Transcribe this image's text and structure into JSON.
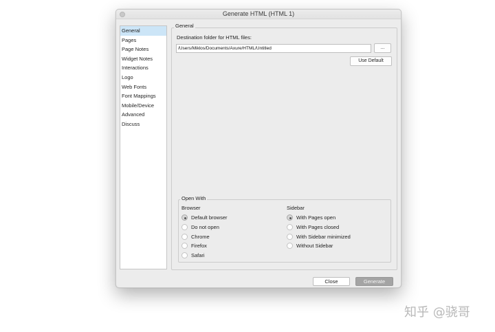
{
  "window": {
    "title": "Generate HTML (HTML 1)"
  },
  "sidebar": {
    "items": [
      {
        "label": "General",
        "selected": true
      },
      {
        "label": "Pages"
      },
      {
        "label": "Page Notes"
      },
      {
        "label": "Widget Notes"
      },
      {
        "label": "Interactions"
      },
      {
        "label": "Logo"
      },
      {
        "label": "Web Fonts"
      },
      {
        "label": "Font Mappings"
      },
      {
        "label": "Mobile/Device"
      },
      {
        "label": "Advanced"
      },
      {
        "label": "Discuss"
      }
    ]
  },
  "general": {
    "group_label": "General",
    "destination_label": "Destination folder for HTML files:",
    "destination_value": "/Users/Miklos/Documents/Axure/HTML/Untitled",
    "browse_label": "...",
    "use_default_label": "Use Default"
  },
  "open_with": {
    "group_label": "Open With",
    "browser": {
      "heading": "Browser",
      "options": [
        "Default browser",
        "Do not open",
        "Chrome",
        "Firefox",
        "Safari"
      ],
      "selected": "Default browser"
    },
    "sidebar": {
      "heading": "Sidebar",
      "options": [
        "With Pages open",
        "With Pages closed",
        "With Sidebar minimized",
        "Without Sidebar"
      ],
      "selected": "With Pages open"
    }
  },
  "footer": {
    "close_label": "Close",
    "generate_label": "Generate"
  },
  "watermark": "知乎 @骁哥",
  "colors": {
    "selection": "#cce5f7",
    "generate_disabled": "#a4a4a4"
  }
}
